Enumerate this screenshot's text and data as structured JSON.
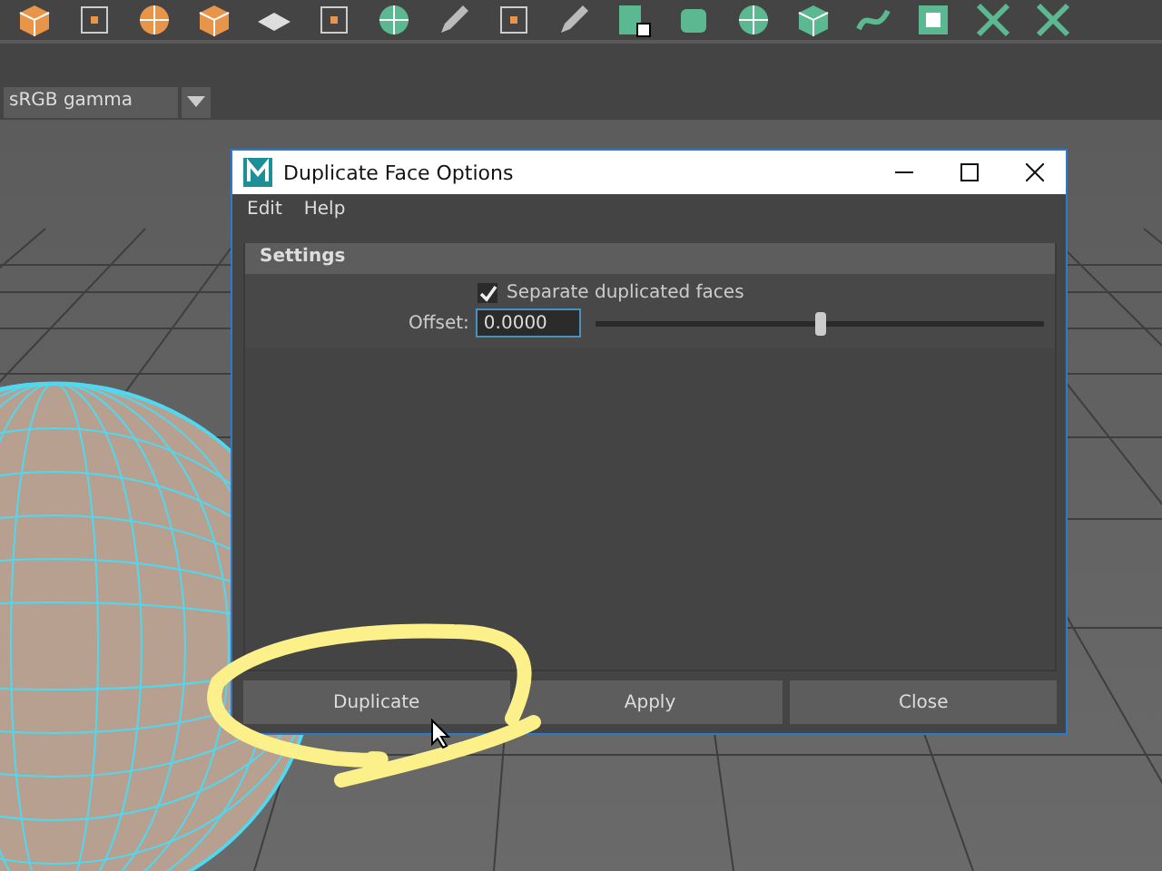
{
  "color_space": {
    "value": "sRGB gamma"
  },
  "dialog": {
    "title": "Duplicate Face Options",
    "menu": [
      {
        "label": "Edit"
      },
      {
        "label": "Help"
      }
    ],
    "section": {
      "title": "Settings"
    },
    "separate": {
      "label": "Separate duplicated faces",
      "checked": true
    },
    "offset": {
      "label": "Offset:",
      "value": "0.0000",
      "level": 0.5
    },
    "buttons": [
      {
        "label": "Duplicate"
      },
      {
        "label": "Apply"
      },
      {
        "label": "Close"
      }
    ]
  }
}
